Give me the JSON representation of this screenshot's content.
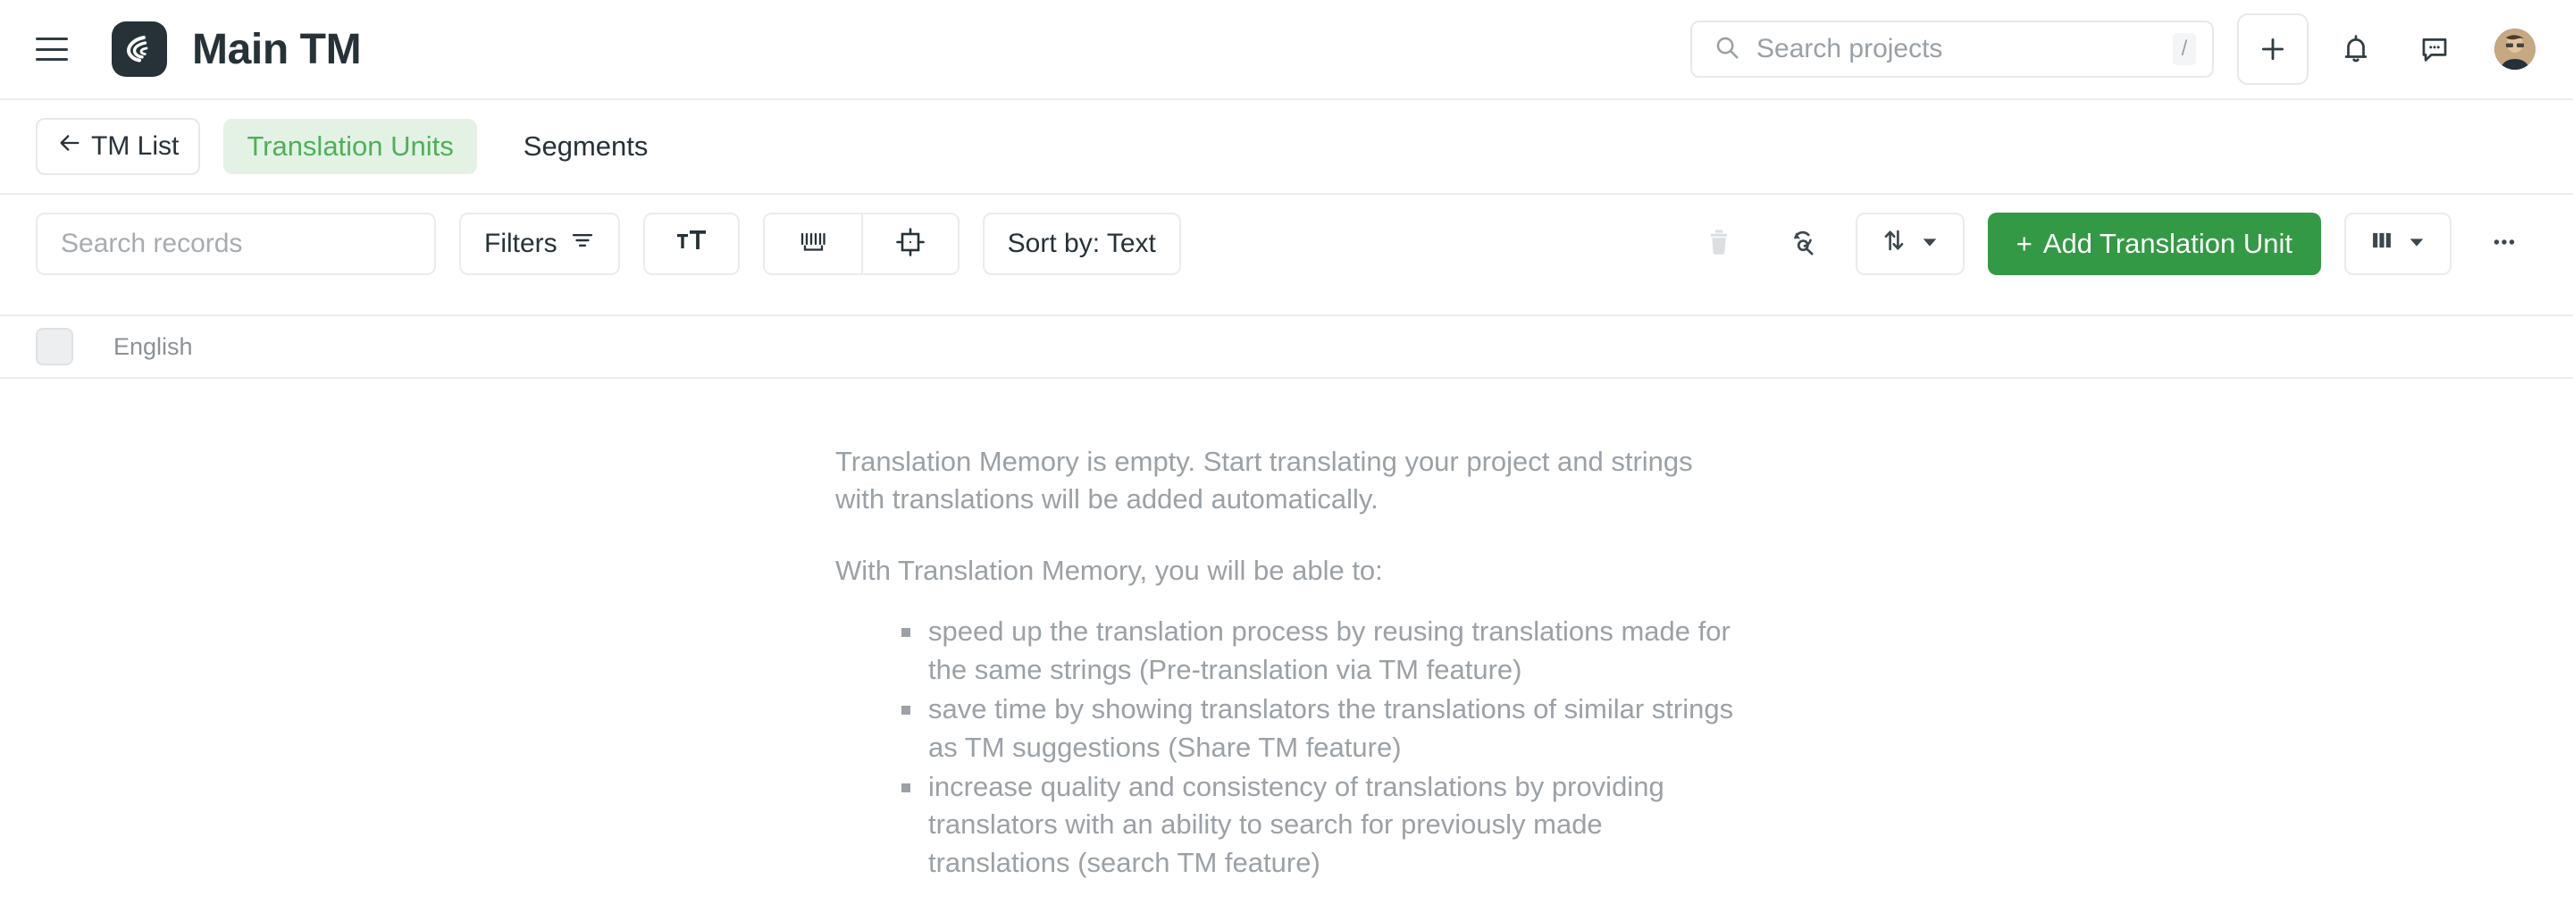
{
  "header": {
    "menu_icon": "hamburger-menu-icon",
    "logo_icon": "crowdin-logo-icon",
    "title": "Main TM",
    "search": {
      "placeholder": "Search projects",
      "value": "",
      "icon": "search-icon",
      "shortcut_key": "/"
    },
    "add_button_label": "+",
    "notifications_icon": "bell-icon",
    "messages_icon": "chat-bubble-icon",
    "avatar_name": "user-avatar"
  },
  "tabs": {
    "back_button": {
      "label": "TM List",
      "icon": "arrow-left-icon"
    },
    "items": [
      {
        "label": "Translation Units",
        "active": true
      },
      {
        "label": "Segments",
        "active": false
      }
    ]
  },
  "toolbar": {
    "search_records": {
      "placeholder": "Search records",
      "value": ""
    },
    "filters_label": "Filters",
    "filters_icon": "filter-icon",
    "font_size_icon": "font-size-icon",
    "whitespace_icon": "show-whitespace-icon",
    "placeholders_icon": "show-placeholders-icon",
    "sort_label": "Sort by: Text",
    "delete_icon": "trash-icon",
    "search_replace_icon": "search-replace-icon",
    "import_export_icon": "import-export-arrows-icon",
    "dropdown_icon": "chevron-down-icon",
    "add_translation_unit_label": "Add Translation Unit",
    "add_translation_unit_plus": "+",
    "columns_icon": "columns-icon",
    "more_icon": "more-horizontal-icon"
  },
  "table": {
    "select_all_name": "select-all-checkbox",
    "columns": [
      {
        "label": "English"
      }
    ]
  },
  "empty_state": {
    "paragraph_1": "Translation Memory is empty. Start translating your project and strings with translations will be added automatically.",
    "paragraph_2": "With Translation Memory, you will be able to:",
    "bullets": [
      "speed up the translation process by reusing translations made for the same strings (Pre-translation via TM feature)",
      "save time by showing translators the translations of similar strings as TM suggestions (Share TM feature)",
      "increase quality and consistency of translations by providing translators with an ability to search for previously made translations (search TM feature)"
    ]
  },
  "colors": {
    "brand_green": "#339944",
    "tab_active_text": "#4eb05a",
    "tab_active_bg": "#e3f2e4",
    "logo_bg": "#263238",
    "muted_text": "#9ba1a6"
  }
}
